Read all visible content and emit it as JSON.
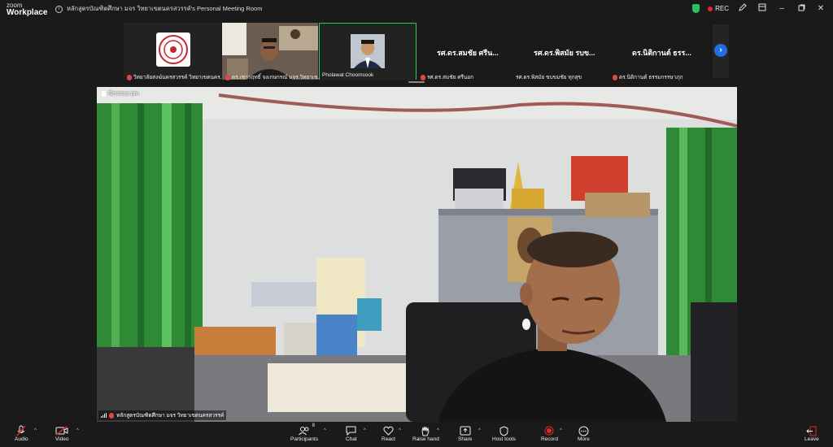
{
  "app": {
    "logo_line1": "zoom",
    "logo_line2": "Workplace"
  },
  "window": {
    "title": "หลักสูตรบัณฑิตศึกษา มจร วิทยาเขตนครสวรรค์'s Personal Meeting Room",
    "rec_label": "REC"
  },
  "participants_strip": [
    {
      "label": "วิทยาลัยสงฆ์นครสวรรค์ วิทยาเขตนคร...",
      "type": "logo",
      "muted": true
    },
    {
      "label": "ดร.เชาวฤทธิ์ จงเกษกรณ์ มจร.วิทยาเข...",
      "type": "video",
      "muted": true
    },
    {
      "label": "Pholawat Choomsook",
      "type": "avatar",
      "muted": false,
      "active": true
    },
    {
      "label": "รศ.ดร.สมชัย ศรีนอก",
      "big_name": "รศ.ดร.สมชัย ศรีน...",
      "type": "name",
      "muted": true
    },
    {
      "label": "รศ.ดร.พิสมัย ขบขมชัย ทุกสุข",
      "big_name": "รศ.ดร.พิสมัย รบข...",
      "type": "name",
      "muted": true
    },
    {
      "label": "ดร.นิติกานต์ ธรรมกรรษาภุก",
      "big_name": "ดร.นิติกานต์ ธรร...",
      "type": "name",
      "muted": true
    }
  ],
  "main_video": {
    "remove_pin_label": "Remove pin",
    "speaker_label": "หลักสูตรบัณฑิตศึกษา มจร วิทยาเขตนครสวรรค์"
  },
  "toolbar": {
    "audio": "Audio",
    "video": "Video",
    "participants": "Participants",
    "participants_count": "8",
    "chat": "Chat",
    "react": "React",
    "raise_hand": "Raise hand",
    "share": "Share",
    "host_tools": "Host tools",
    "record": "Record",
    "more": "More",
    "leave": "Leave"
  },
  "colors": {
    "accent": "#1f6fe0",
    "active_border": "#34c759",
    "muted": "#e04848",
    "record": "#e02828",
    "shield": "#2ec05c"
  },
  "icons": [
    "info-icon",
    "shield-icon",
    "record-dot-icon",
    "edit-icon",
    "grid-icon",
    "minimize-icon",
    "restore-icon",
    "close-icon",
    "chevron-right-icon",
    "pin-icon",
    "mic-off-icon",
    "camera-off-icon",
    "participants-icon",
    "chat-icon",
    "react-icon",
    "raise-hand-icon",
    "share-icon",
    "host-tools-icon",
    "record-icon",
    "more-icon",
    "leave-icon"
  ]
}
